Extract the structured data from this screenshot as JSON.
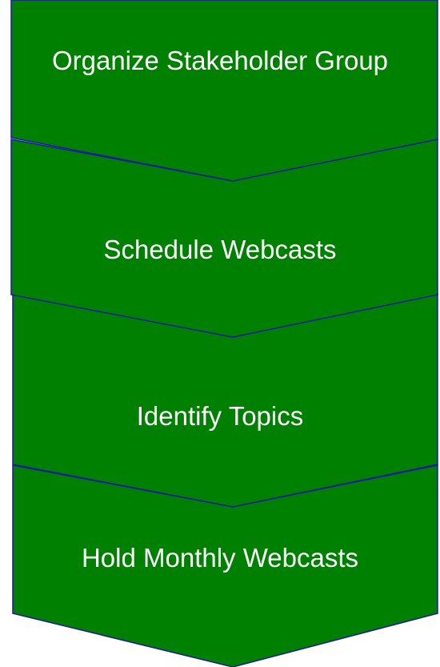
{
  "diagram": {
    "fill_color": "#008000",
    "stroke_color": "#1a1aa0",
    "steps": [
      {
        "label": "Organize Stakeholder Group"
      },
      {
        "label": "Schedule Webcasts"
      },
      {
        "label": "Identify Topics"
      },
      {
        "label": "Hold Monthly Webcasts"
      }
    ]
  }
}
